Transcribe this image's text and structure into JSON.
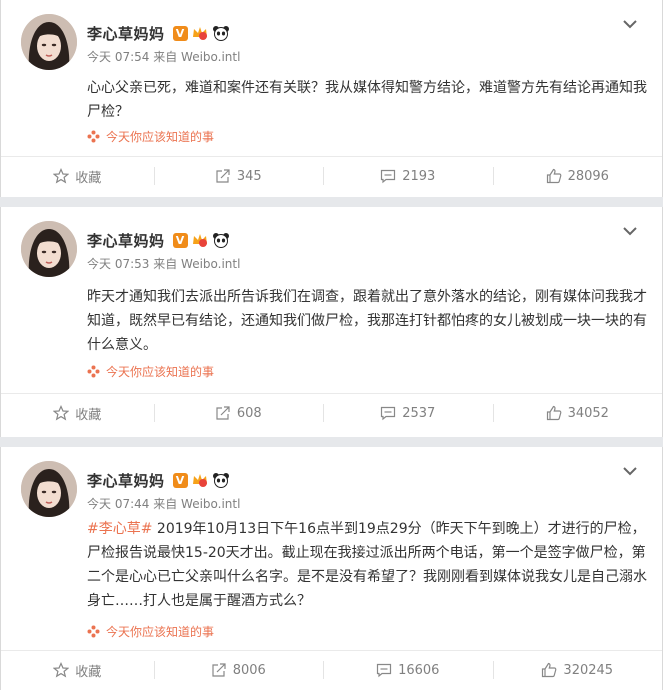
{
  "posts": [
    {
      "author": "李心草妈妈",
      "badge_v": "V",
      "time_source": "今天 07:54 来自 Weibo.intl",
      "content": "心心父亲已死，难道和案件还有关联？我从媒体得知警方结论，难道警方先有结论再通知我尸检？",
      "topic": "",
      "recommend": "今天你应该知道的事",
      "actions": {
        "collect": "收藏",
        "repost": "345",
        "comment": "2193",
        "like": "28096"
      }
    },
    {
      "author": "李心草妈妈",
      "badge_v": "V",
      "time_source": "今天 07:53 来自 Weibo.intl",
      "content": "昨天才通知我们去派出所告诉我们在调查，跟着就出了意外落水的结论，刚有媒体问我我才知道，既然早已有结论，还通知我们做尸检，我那连打针都怕疼的女儿被划成一块一块的有什么意义。",
      "topic": "",
      "recommend": "今天你应该知道的事",
      "actions": {
        "collect": "收藏",
        "repost": "608",
        "comment": "2537",
        "like": "34052"
      }
    },
    {
      "author": "李心草妈妈",
      "badge_v": "V",
      "time_source": "今天 07:44 来自 Weibo.intl",
      "content": " 2019年10月13日下午16点半到19点29分（昨天下午到晚上）才进行的尸检，尸检报告说最快15-20天才出。截止现在我接过派出所两个电话，第一个是签字做尸检，第二个是心心已亡父亲叫什么名字。是不是没有希望了？我刚刚看到媒体说我女儿是自己溺水身亡……打人也是属于醒酒方式么？",
      "topic": "#李心草#",
      "recommend": "今天你应该知道的事",
      "actions": {
        "collect": "收藏",
        "repost": "8006",
        "comment": "16606",
        "like": "320245"
      }
    }
  ],
  "icons": {
    "more": "chevron-down-icon",
    "collect": "star-icon",
    "repost": "share-icon",
    "comment": "comment-icon",
    "like": "thumbs-up-icon",
    "recommend": "flower-icon",
    "verified": "v-badge-icon",
    "crown": "crown-badge-icon",
    "panda": "panda-badge-icon"
  },
  "colors": {
    "accent": "#eb7350",
    "verified": "#f08c1a",
    "muted": "#808080"
  }
}
